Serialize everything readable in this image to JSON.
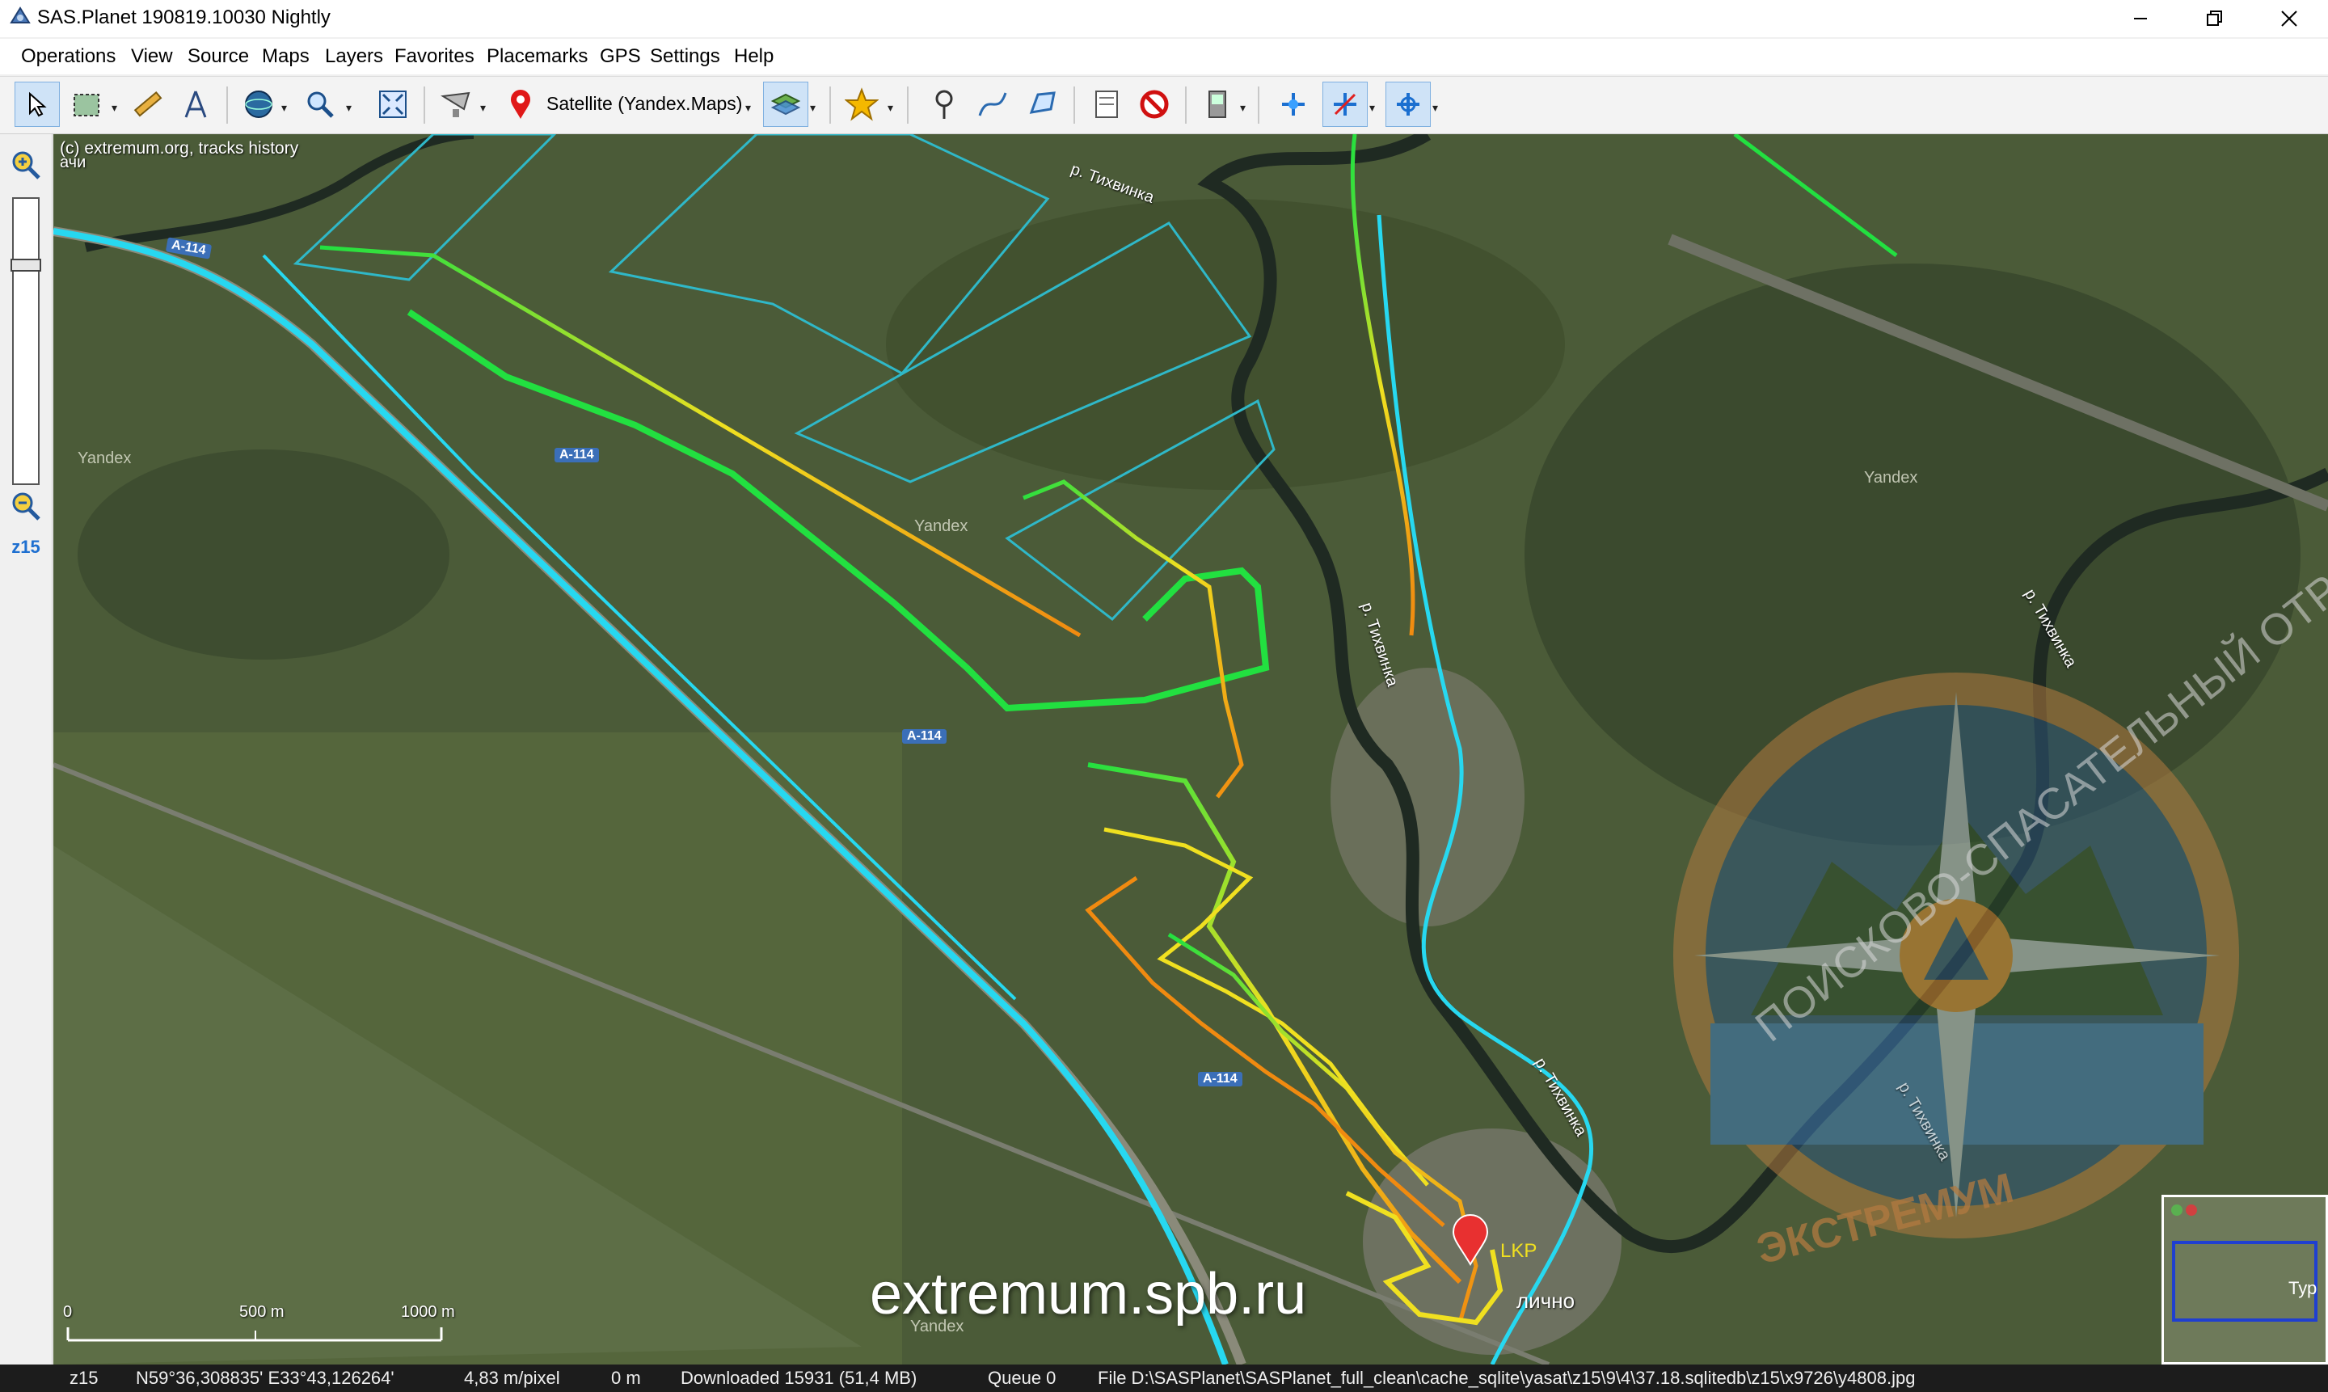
{
  "window": {
    "title": "SAS.Planet 190819.10030 Nightly",
    "minimize_icon": "minimize-icon",
    "maximize_icon": "restore-icon",
    "close_icon": "close-icon"
  },
  "menu": [
    "Operations",
    "View",
    "Source",
    "Maps",
    "Layers",
    "Favorites",
    "Placemarks",
    "GPS",
    "Settings",
    "Help"
  ],
  "toolbar": {
    "map_source": "Satellite (Yandex.Maps)",
    "tools": [
      "select-pointer",
      "select-region",
      "ruler",
      "polygon-calc",
      "map-type-globe",
      "zoom-magnifier",
      "fullscreen",
      "source-selector",
      "placemark-marker",
      "layers",
      "favorites-star",
      "add-placemark",
      "add-path",
      "add-polygon",
      "placemark-manager",
      "hide-placemarks",
      "gps-panel",
      "gps-connect",
      "gps-track",
      "gps-center"
    ]
  },
  "zoom": {
    "level": "z15",
    "slider_fraction": 0.22
  },
  "map": {
    "copyright": "(c) extremum.org, tracks history",
    "labels": {
      "yandex": "Yandex",
      "river": "р. Тихвинка",
      "road": "А-114",
      "place_fragment_top": "ачи",
      "place_fragment_bottom": "лично",
      "marker_label": "LKP",
      "minimap_fragment": "Тур"
    },
    "scale": {
      "zero": "0",
      "mid": "500 m",
      "end": "1000 m"
    },
    "watermark": {
      "url": "extremum.spb.ru",
      "logo_top_text": "ПОИСКОВО-СПАСАТЕЛЬНЫЙ ОТРЯД",
      "logo_bottom_text": "ЭКСТРЕМУМ"
    }
  },
  "statusbar": {
    "zoom": "z15",
    "coords": "N59°36,308835' E33°43,126264'",
    "scale": "4,83 m/pixel",
    "distance": "0 m",
    "downloaded": "Downloaded 15931 (51,4 MB)",
    "queue": "Queue 0",
    "file": "File D:\\SASPlanet\\SASPlanet_full_clean\\cache_sqlite\\yasat\\z15\\9\\4\\37.18.sqlitedb\\z15\\x9726\\y4808.jpg"
  },
  "colors": {
    "road_track": "#27d8f0",
    "grid": "#2fb8c8",
    "track_green": "#22e040",
    "track_yellow": "#f0e020",
    "track_orange": "#f08a10",
    "zoom_label": "#1e6fd0",
    "statusbar_bg": "#1c1c1c"
  }
}
